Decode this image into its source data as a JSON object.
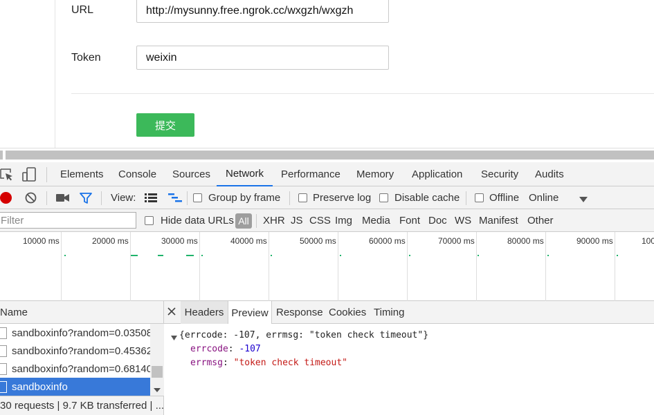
{
  "form": {
    "url_label": "URL",
    "url_value": "http://mysunny.free.ngrok.cc/wxgzh/wxgzh",
    "token_label": "Token",
    "token_value": "weixin",
    "submit_label": "提交"
  },
  "devtools": {
    "tabs": [
      "Elements",
      "Console",
      "Sources",
      "Network",
      "Performance",
      "Memory",
      "Application",
      "Security",
      "Audits"
    ],
    "active_tab": "Network",
    "toolbar": {
      "view_label": "View:",
      "group_by_frame": "Group by frame",
      "preserve_log": "Preserve log",
      "disable_cache": "Disable cache",
      "offline": "Offline",
      "throttle": "Online"
    },
    "filter": {
      "placeholder": "Filter",
      "hide_data_urls": "Hide data URLs",
      "types": [
        "All",
        "XHR",
        "JS",
        "CSS",
        "Img",
        "Media",
        "Font",
        "Doc",
        "WS",
        "Manifest",
        "Other"
      ]
    },
    "overview_ticks": [
      "10000 ms",
      "20000 ms",
      "30000 ms",
      "40000 ms",
      "50000 ms",
      "60000 ms",
      "70000 ms",
      "80000 ms",
      "90000 ms",
      "100"
    ],
    "list": {
      "header": "Name",
      "rows": [
        "sandboxinfo?random=0.03508",
        "sandboxinfo?random=0.45362",
        "sandboxinfo?random=0.68140",
        "sandboxinfo"
      ],
      "selected_index": 3,
      "status": "30 requests | 9.7 KB transferred | ..."
    },
    "detail": {
      "tabs": [
        "Headers",
        "Preview",
        "Response",
        "Cookies",
        "Timing"
      ],
      "active_tab": "Preview",
      "summary": "{errcode: -107, errmsg: \"token check timeout\"}",
      "errcode_key": "errcode",
      "errcode_value": "-107",
      "errmsg_key": "errmsg",
      "errmsg_value": "\"token check timeout\""
    }
  }
}
